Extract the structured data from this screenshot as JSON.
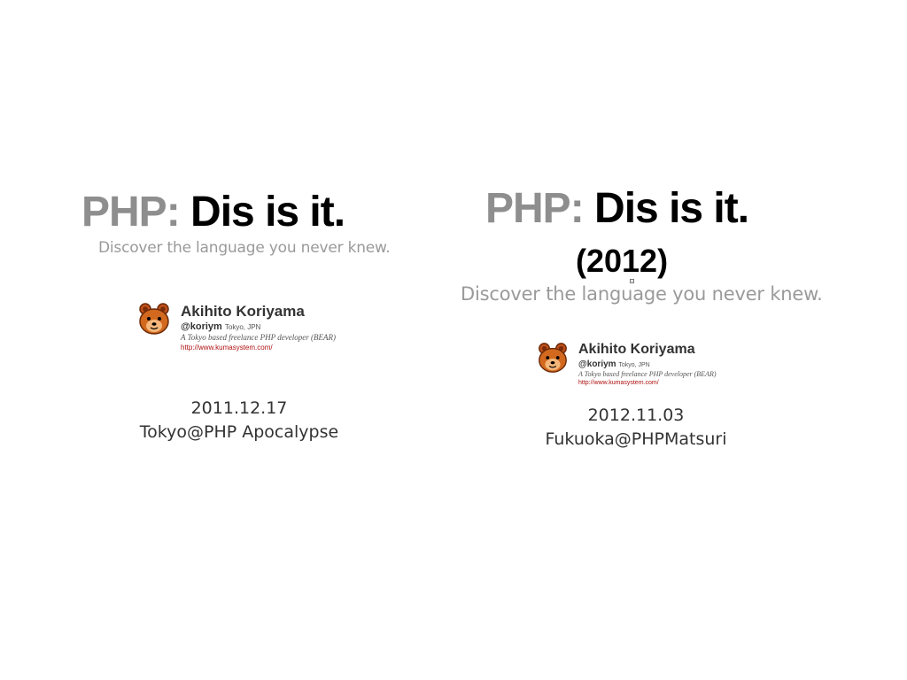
{
  "colors": {
    "php_gray": "#8e8e8e",
    "headline_black": "#000000",
    "tagline_gray": "#9a9a9a",
    "url_red": "#b01010",
    "avatar_orange": "#d2691e"
  },
  "left": {
    "headline": {
      "php": "PHP:",
      "rest": "Dis is it."
    },
    "tagline": "Discover the language you never knew.",
    "profile": {
      "avatar_icon": "bear-avatar-icon",
      "name": "Akihito Koriyama",
      "handle": "@koriym",
      "location": "Tokyo, JPN",
      "bio": "A Tokyo based freelance PHP developer (BEAR)",
      "url": "http://www.kumasystem.com/"
    },
    "date": "2011.12.17",
    "event": "Tokyo@PHP Apocalypse"
  },
  "right": {
    "headline": {
      "php": "PHP:",
      "rest": "Dis is it."
    },
    "year": "(2012)",
    "tagline": "Discover the language you never knew.",
    "profile": {
      "avatar_icon": "bear-avatar-icon",
      "name": "Akihito Koriyama",
      "handle": "@koriym",
      "location": "Tokyo, JPN",
      "bio": "A Tokyo based freelance PHP developer (BEAR)",
      "url": "http://www.kumasystem.com/"
    },
    "date": "2012.11.03",
    "event": "Fukuoka@PHPMatsuri"
  }
}
